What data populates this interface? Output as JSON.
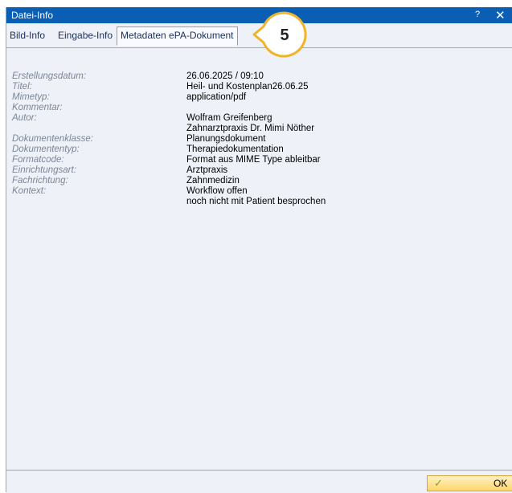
{
  "window": {
    "title": "Datei-Info",
    "help_glyph": "?",
    "close_glyph": "✕"
  },
  "tabs": [
    {
      "label": "Bild-Info"
    },
    {
      "label": "Eingabe-Info"
    },
    {
      "label": "Metadaten ePA-Dokument",
      "active": true
    }
  ],
  "callout": {
    "number": "5",
    "color": "#f0b429"
  },
  "metadata": {
    "labels": {
      "erstellungsdatum": "Erstellungsdatum:",
      "titel": "Titel:",
      "mimetyp": "Mimetyp:",
      "kommentar": "Kommentar:",
      "autor": "Autor:",
      "dokumentenklasse": "Dokumentenklasse:",
      "dokumententyp": "Dokumententyp:",
      "formatcode": "Formatcode:",
      "einrichtungsart": "Einrichtungsart:",
      "fachrichtung": "Fachrichtung:",
      "kontext": "Kontext:"
    },
    "values": {
      "erstellungsdatum": "26.06.2025 / 09:10",
      "titel": "Heil- und Kostenplan26.06.25",
      "mimetyp": "application/pdf",
      "autor_1": "Wolfram Greifenberg",
      "autor_2": "Zahnarztpraxis Dr. Mimi Nöther",
      "dokumentenklasse": "Planungsdokument",
      "dokumententyp": "Therapiedokumentation",
      "formatcode": "Format aus MIME Type ableitbar",
      "einrichtungsart": "Arztpraxis",
      "fachrichtung": "Zahnmedizin",
      "kontext_1": "Workflow offen",
      "kontext_2": "noch nicht mit Patient besprochen"
    }
  },
  "footer": {
    "ok_label": "OK",
    "ok_icon": "check-icon"
  },
  "colors": {
    "titlebar": "#0a5fb4",
    "panel": "#eef2f8",
    "accent_button": "#ffd66a"
  }
}
